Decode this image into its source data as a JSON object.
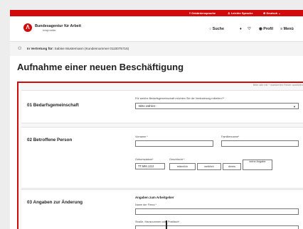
{
  "topbar": {
    "sign_language": "Gebärdensprache",
    "easy_language": "Leichte Sprache",
    "language": "Deutsch"
  },
  "header": {
    "brand": "Bundesagentur für Arbeit",
    "tagline": "bringt weiter.",
    "search": "Suche",
    "profile": "Profil",
    "menu": "Menü"
  },
  "proxy": {
    "prefix": "In Vertretung für:",
    "name": "Sabine Mustermann (Kundennummer 0110075716)"
  },
  "page": {
    "title": "Aufnahme einer neuen Beschäftigung"
  },
  "form": {
    "hint": "Bitte alle mit * markierten Felder ausfüllen",
    "s1": {
      "title": "01 Bedarfsgemeinschaft",
      "label": "Für welche Bedarfsgemeinschaft möchten Sie die Veränderung mitteilen?*",
      "value": "-Bitte wählen-"
    },
    "s2": {
      "title": "02 Betroffene Person",
      "first_name_label": "Vorname *",
      "last_name_label": "Familienname*",
      "birthdate_label": "Geburtsdatum*",
      "birthdate_placeholder": "TT.MM.JJJJ",
      "gender_label": "Geschlecht *",
      "gender_options": [
        "männlich",
        "weiblich",
        "divers",
        "keine Angabe"
      ]
    },
    "s3": {
      "title": "03 Angaben zur Änderung",
      "employer_heading": "Angaben zum Arbeitgeber",
      "company_label": "Name der Firma *",
      "street_label": "Straße, Hausnummer oder Postfach*"
    }
  }
}
